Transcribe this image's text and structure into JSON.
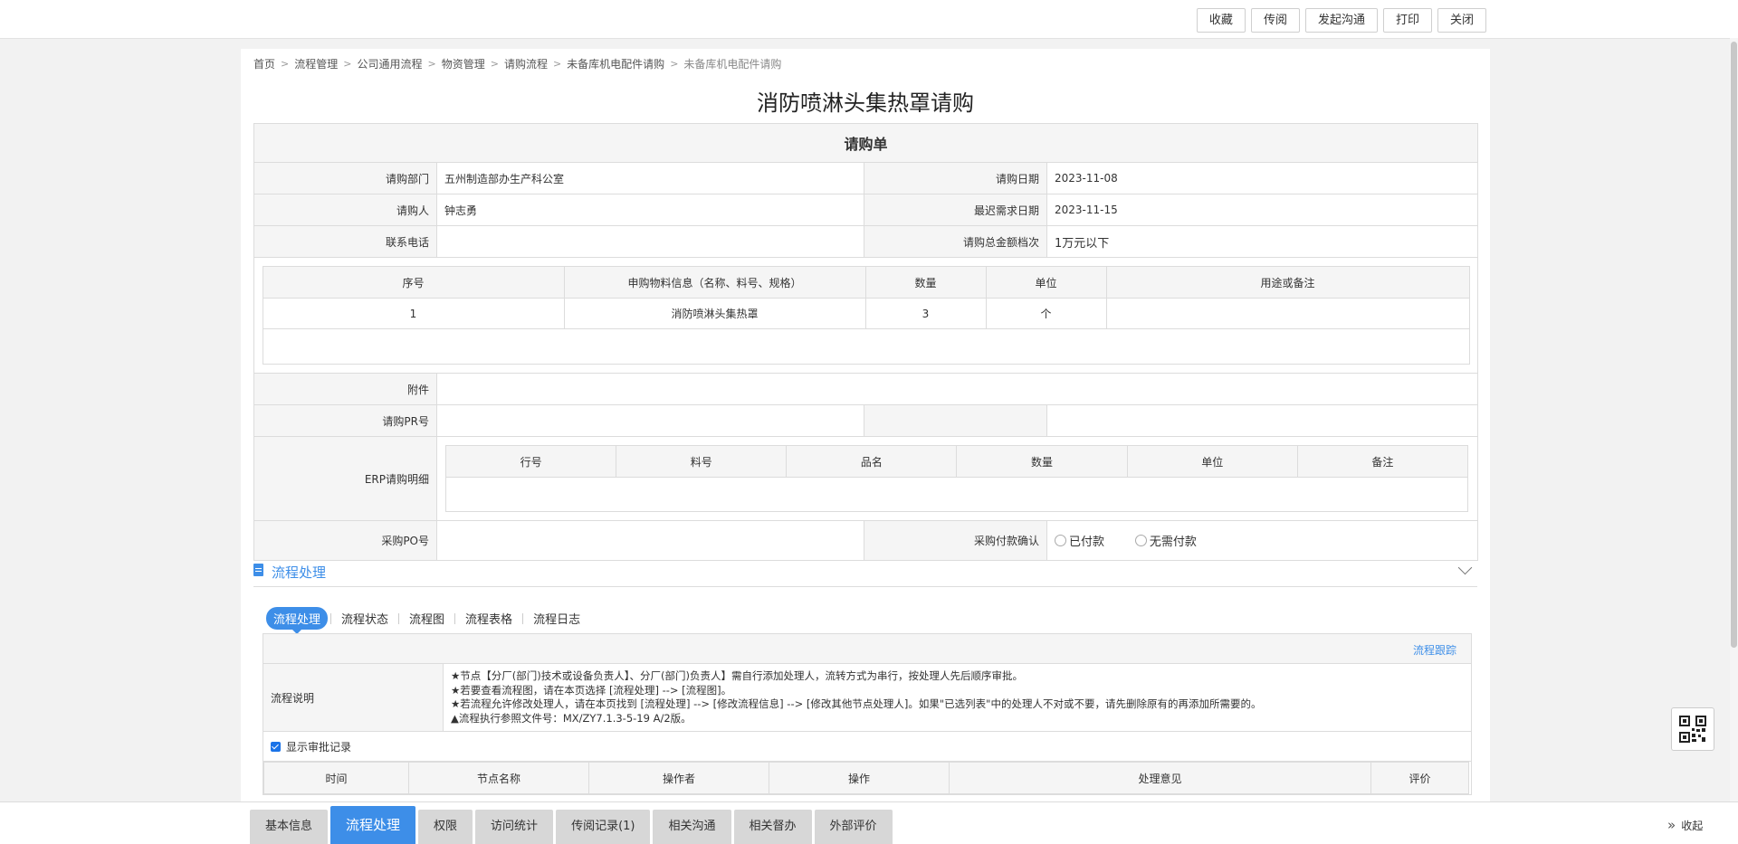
{
  "toolbar": {
    "buttons": [
      "收藏",
      "传阅",
      "发起沟通",
      "打印",
      "关闭"
    ]
  },
  "breadcrumb": [
    "首页",
    "流程管理",
    "公司通用流程",
    "物资管理",
    "请购流程",
    "未备库机电配件请购",
    "未备库机电配件请购"
  ],
  "page_title": "消防喷淋头集热罩请购",
  "form": {
    "heading": "请购单",
    "dept_label": "请购部门",
    "dept_value": "五州制造部办生产科公室",
    "date_label": "请购日期",
    "date_value": "2023-11-08",
    "person_label": "请购人",
    "person_value": "钟志勇",
    "need_date_label": "最迟需求日期",
    "need_date_value": "2023-11-15",
    "phone_label": "联系电话",
    "phone_value": "",
    "amount_label": "请购总金额档次",
    "amount_value": "1万元以下",
    "items_headers": [
      "序号",
      "申购物料信息（名称、料号、规格）",
      "数量",
      "单位",
      "用途或备注"
    ],
    "items_rows": [
      [
        "1",
        "消防喷淋头集热罩",
        "3",
        "个",
        ""
      ]
    ],
    "attach_label": "附件",
    "pr_label": "请购PR号",
    "erp_label": "ERP请购明细",
    "erp_headers": [
      "行号",
      "料号",
      "品名",
      "数量",
      "单位",
      "备注"
    ],
    "po_label": "采购PO号",
    "pay_label": "采购付款确认",
    "pay_options": [
      "已付款",
      "无需付款"
    ]
  },
  "process": {
    "section_title": "流程处理",
    "tabs": [
      "流程处理",
      "流程状态",
      "流程图",
      "流程表格",
      "流程日志"
    ],
    "trace_link": "流程跟踪",
    "desc_label": "流程说明",
    "desc_lines": [
      "★节点【分厂(部门)技术或设备负责人】、分厂(部门)负责人】需自行添加处理人，流转方式为串行，按处理人先后顺序审批。",
      "★若要查看流程图，请在本页选择 [流程处理] --> [流程图]。",
      "★若流程允许修改处理人，请在本页找到 [流程处理] --> [修改流程信息] --> [修改其他节点处理人]。如果\"已选列表\"中的处理人不对或不要，请先删除原有的再添加所需要的。",
      "▲流程执行参照文件号：MX/ZY7.1.3-5-19 A/2版。"
    ],
    "show_records_label": "显示审批记录",
    "log_headers": [
      "时间",
      "节点名称",
      "操作者",
      "操作",
      "处理意见",
      "评价"
    ]
  },
  "bottom_tabs": [
    "基本信息",
    "流程处理",
    "权限",
    "访问统计",
    "传阅记录(1)",
    "相关沟通",
    "相关督办",
    "外部评价"
  ],
  "bottom_active": "流程处理",
  "collapse_label": "收起",
  "colors": {
    "accent": "#3d8ee8",
    "header_bg": "#f5f5f5",
    "border": "#dcdcdc"
  }
}
